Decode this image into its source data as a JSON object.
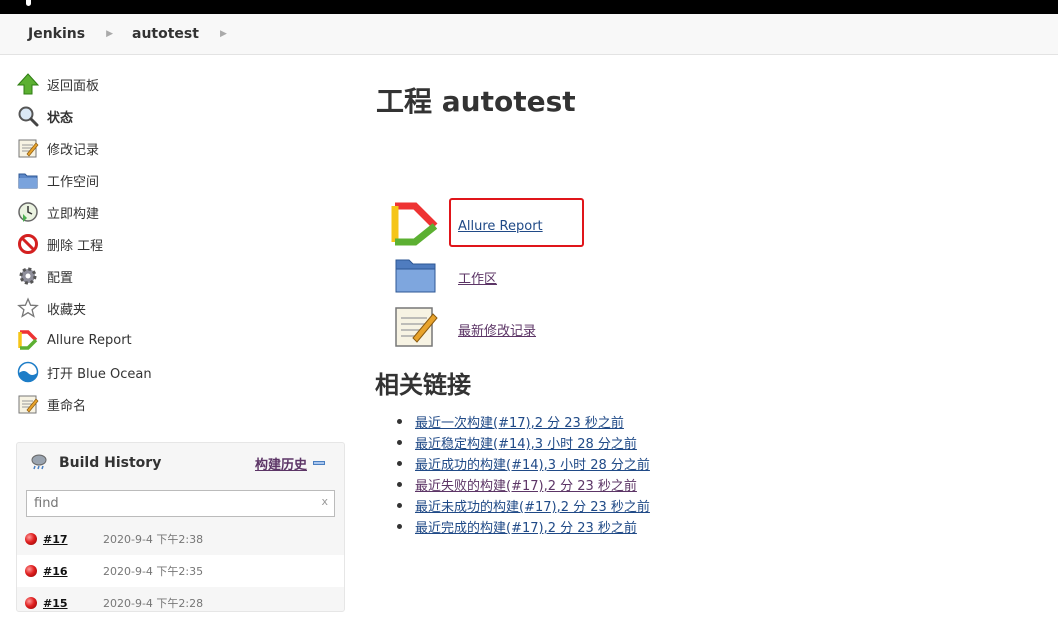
{
  "breadcrumb": {
    "root": "Jenkins",
    "project": "autotest"
  },
  "sidebar": {
    "items": [
      {
        "label": "返回面板",
        "icon": "up-arrow-icon"
      },
      {
        "label": "状态",
        "icon": "magnifier-icon"
      },
      {
        "label": "修改记录",
        "icon": "notepad-icon"
      },
      {
        "label": "工作空间",
        "icon": "folder-icon"
      },
      {
        "label": "立即构建",
        "icon": "clock-build-icon"
      },
      {
        "label": "删除 工程",
        "icon": "no-entry-icon"
      },
      {
        "label": "配置",
        "icon": "gear-icon"
      },
      {
        "label": "收藏夹",
        "icon": "star-icon"
      },
      {
        "label": "Allure Report",
        "icon": "allure-icon"
      },
      {
        "label": "打开 Blue Ocean",
        "icon": "blue-ocean-icon"
      },
      {
        "label": "重命名",
        "icon": "notepad-icon"
      }
    ]
  },
  "build_history": {
    "title": "Build History",
    "trend_link": "构建历史",
    "filter_placeholder": "find",
    "clear": "x",
    "builds": [
      {
        "number": "#17",
        "date": "2020-9-4 下午2:38",
        "status": "failed"
      },
      {
        "number": "#16",
        "date": "2020-9-4 下午2:35",
        "status": "failed"
      },
      {
        "number": "#15",
        "date": "2020-9-4 下午2:28",
        "status": "failed"
      }
    ]
  },
  "main": {
    "title": "工程 autotest",
    "links": [
      {
        "label": "Allure Report",
        "icon": "allure-icon"
      },
      {
        "label": "工作区",
        "icon": "folder-icon"
      },
      {
        "label": "最新修改记录",
        "icon": "notepad-icon"
      }
    ],
    "related_title": "相关链接",
    "related": [
      "最近一次构建(#17),2 分 23 秒之前",
      "最近稳定构建(#14),3 小时 28 分之前",
      "最近成功的构建(#14),3 小时 28 分之前",
      "最近失败的构建(#17),2 分 23 秒之前",
      "最近未成功的构建(#17),2 分 23 秒之前",
      "最近完成的构建(#17),2 分 23 秒之前"
    ]
  },
  "colors": {
    "link": "#204a87",
    "visited": "#5c3566",
    "highlight": "#e0151a",
    "failed": "#e02020"
  }
}
